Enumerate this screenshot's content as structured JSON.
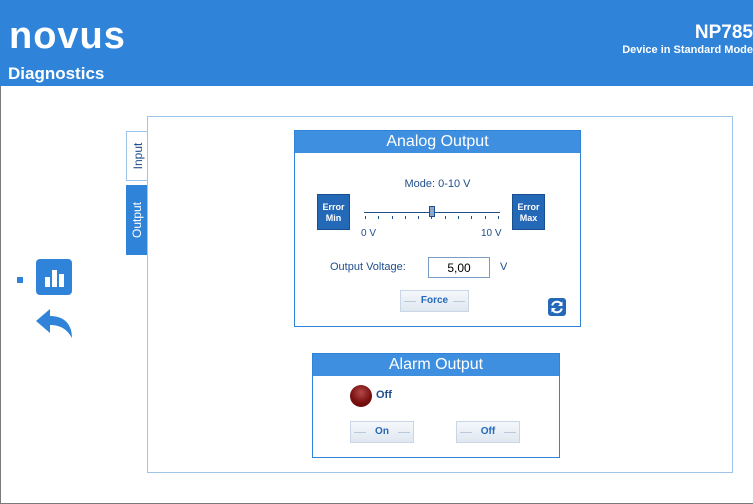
{
  "header": {
    "logo_text": "novus",
    "page_title": "Diagnostics",
    "device_model": "NP785",
    "device_mode": "Device in Standard Mode",
    "background_color": "#2f83d9"
  },
  "nav": {
    "diagnostics_icon": "bar-chart-icon",
    "back_icon": "back-arrow-icon"
  },
  "tabs": [
    {
      "label": "Input",
      "active": false
    },
    {
      "label": "Output",
      "active": true
    }
  ],
  "analog_output": {
    "title": "Analog Output",
    "mode_label": "Mode: 0-10 V",
    "error_min_label_1": "Error",
    "error_min_label_2": "Min",
    "error_max_label_1": "Error",
    "error_max_label_2": "Max",
    "slider_min_label": "0 V",
    "slider_max_label": "10 V",
    "slider_value_fraction": 0.5,
    "output_voltage_label": "Output Voltage:",
    "output_voltage_value": "5,00",
    "output_voltage_unit": "V",
    "force_button_label": "Force",
    "refresh_icon": "refresh-icon"
  },
  "alarm_output": {
    "title": "Alarm Output",
    "state_label": "Off",
    "state_color": "#7a1010",
    "on_button_label": "On",
    "off_button_label": "Off"
  }
}
